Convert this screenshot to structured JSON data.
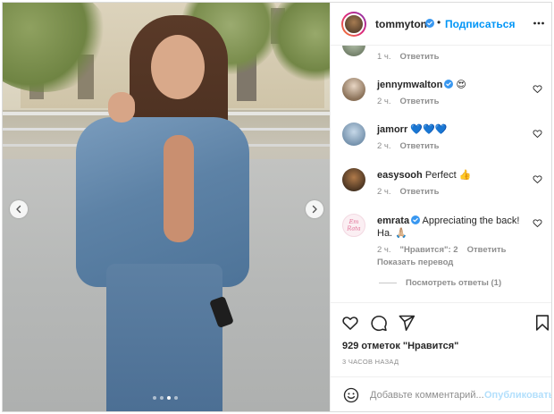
{
  "post": {
    "author": "tommyton",
    "dot": "•",
    "follow_label": "Подписаться",
    "likes_text": "929 отметок \"Нравится\"",
    "time_text": "3 ЧАСОВ НАЗАД",
    "carousel": {
      "slides": 4,
      "active_index": 2
    }
  },
  "comments": [
    {
      "meta_time": "1 ч.",
      "reply_label": "Ответить"
    },
    {
      "user": "jennymwalton",
      "verified": true,
      "text": "😍",
      "meta_time": "2 ч.",
      "reply_label": "Ответить"
    },
    {
      "user": "jamorr",
      "verified": false,
      "text": "💙💙💙",
      "meta_time": "2 ч.",
      "reply_label": "Ответить"
    },
    {
      "user": "easysooh",
      "verified": false,
      "text": "Perfect 👍",
      "meta_time": "2 ч.",
      "reply_label": "Ответить"
    },
    {
      "user": "emrata",
      "verified": true,
      "text": "Appreciating the back! Ha. 🙏🏼",
      "meta_time": "2 ч.",
      "likes_label": "\"Нравится\": 2",
      "reply_label": "Ответить",
      "translate_label": "Показать перевод"
    }
  ],
  "view_replies_label": "Посмотреть ответы (1)",
  "composer": {
    "placeholder": "Добавьте комментарий...",
    "publish_label": "Опубликовать"
  },
  "colors": {
    "accent": "#0095f6",
    "verified": "#3897f0",
    "muted": "#8e8e8e",
    "publish_disabled": "#b2dffc"
  },
  "icons": [
    "chevron-left-icon",
    "chevron-right-icon",
    "more-icon",
    "verified-icon",
    "heart-icon",
    "comment-icon",
    "share-icon",
    "bookmark-icon",
    "emoji-icon"
  ]
}
